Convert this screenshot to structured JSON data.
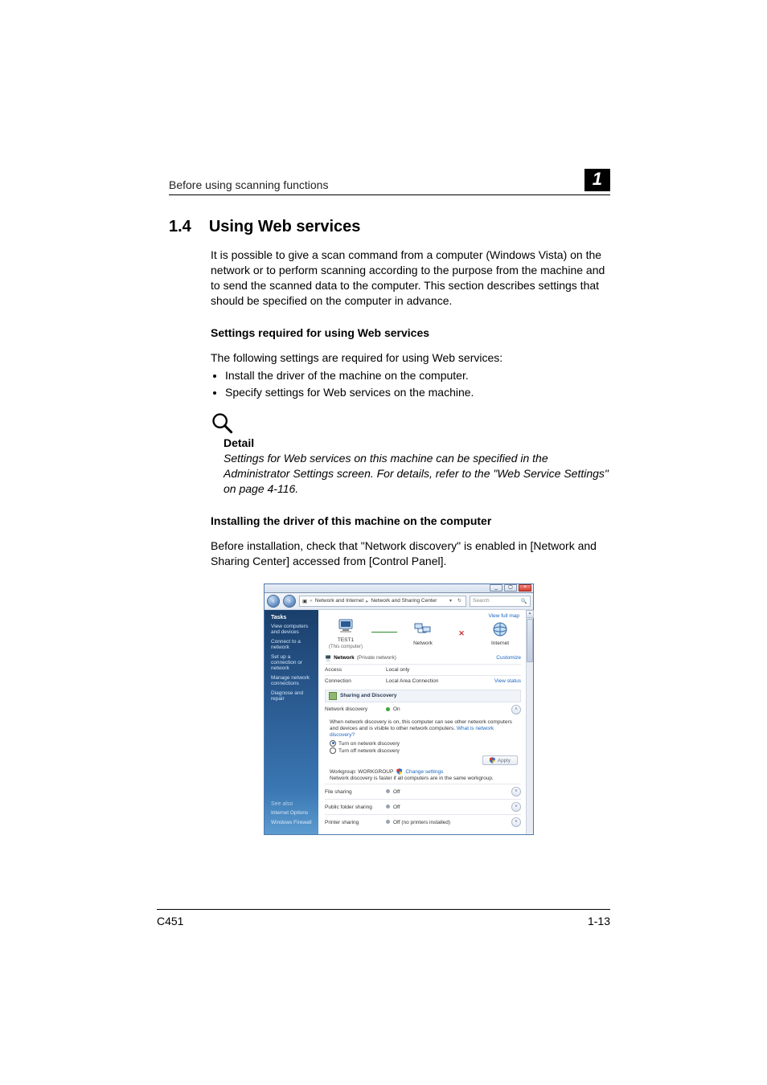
{
  "header": {
    "running": "Before using scanning functions",
    "chapter": "1"
  },
  "section": {
    "number": "1.4",
    "title": "Using Web services"
  },
  "intro": "It is possible to give a scan command from a computer (Windows Vista) on the network or to perform scanning according to the purpose from the machine and to send the scanned data to the computer. This section describes settings that should be specified on the computer in advance.",
  "sub1": {
    "heading": "Settings required for using Web services",
    "lead": "The following settings are required for using Web services:",
    "items": [
      "Install the driver of the machine on the computer.",
      "Specify settings for Web services on the machine."
    ]
  },
  "detail": {
    "label": "Detail",
    "text": "Settings for Web services on this machine can be specified in the Administrator Settings screen. For details, refer to the \"Web Service Settings\" on page 4-116."
  },
  "sub2": {
    "heading": "Installing the driver of this machine on the computer",
    "lead": "Before installation, check that \"Network discovery\" is enabled in [Network and Sharing Center] accessed from [Control Panel]."
  },
  "footer": {
    "model": "C451",
    "page": "1-13"
  },
  "net": {
    "breadcrumb": {
      "a": "Network and Internet",
      "b": "Network and Sharing Center"
    },
    "search_placeholder": "Search",
    "sidebar": {
      "tasks": "Tasks",
      "links": [
        "View computers and devices",
        "Connect to a network",
        "Set up a connection or network",
        "Manage network connections",
        "Diagnose and repair"
      ],
      "seealso": "See also",
      "bottom": [
        "Internet Options",
        "Windows Firewall"
      ]
    },
    "map": {
      "viewfull": "View full map",
      "node1": {
        "name": "TEST1",
        "sub": "(This computer)"
      },
      "node2": {
        "name": "Network"
      },
      "node3": {
        "name": "Internet"
      }
    },
    "netline": {
      "label_prefix": "Network",
      "label_suffix": "(Private network)",
      "customize": "Customize"
    },
    "rows": {
      "access": {
        "k": "Access",
        "v": "Local only"
      },
      "connection": {
        "k": "Connection",
        "v": "Local Area Connection",
        "r": "View status"
      }
    },
    "sharing_head": "Sharing and Discovery",
    "discovery": {
      "k": "Network discovery",
      "v": "On",
      "desc_a": "When network discovery is on, this computer can see other network computers and devices and is visible to other network computers. ",
      "desc_link": "What is network discovery?",
      "opt_on": "Turn on network discovery",
      "opt_off": "Turn off network discovery",
      "apply": "Apply"
    },
    "workgroup": {
      "label": "Workgroup: WORKGROUP",
      "change": "Change settings",
      "faster": "Network discovery is faster if all computers are in the same workgroup."
    },
    "share_rows": {
      "file": {
        "k": "File sharing",
        "v": "Off"
      },
      "public": {
        "k": "Public folder sharing",
        "v": "Off"
      },
      "printer": {
        "k": "Printer sharing",
        "v": "Off (no printers installed)"
      }
    }
  }
}
